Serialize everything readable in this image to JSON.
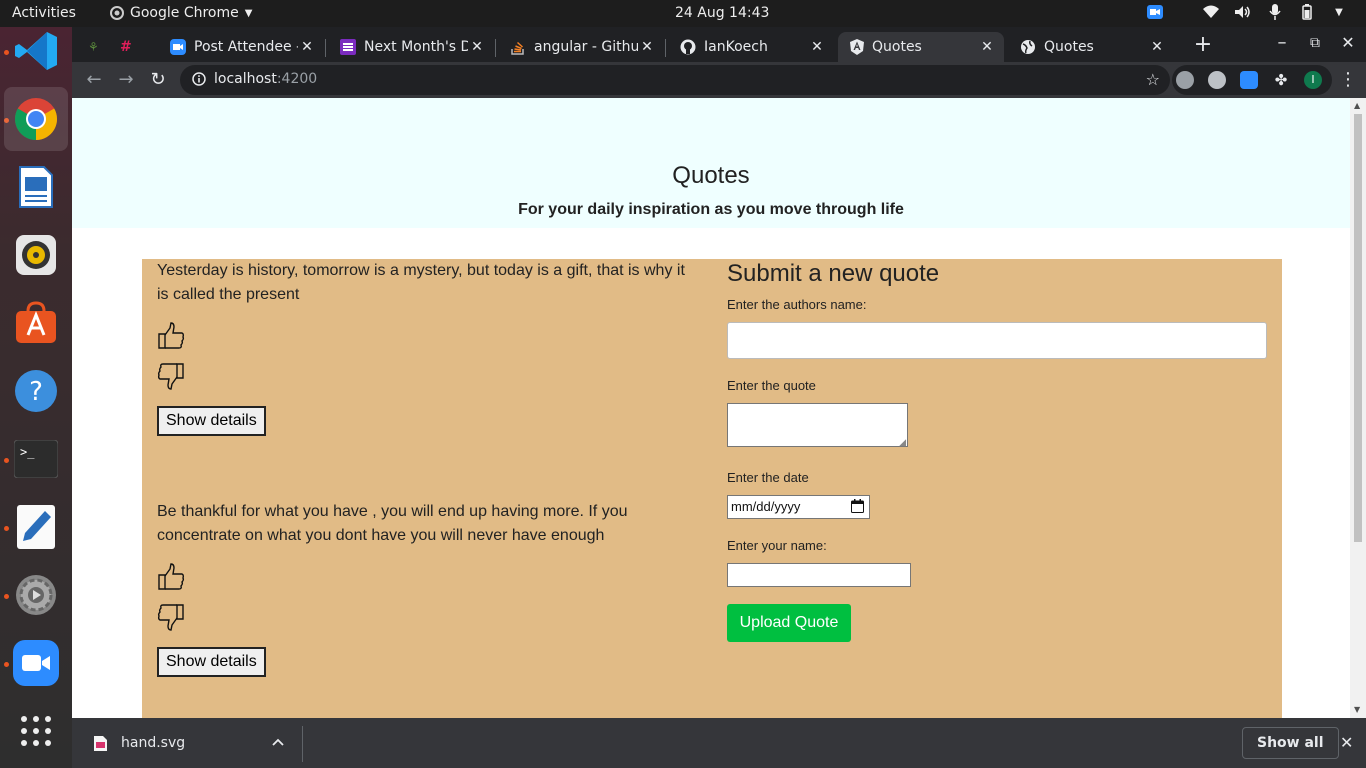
{
  "topbar": {
    "activities": "Activities",
    "app_name": "Google Chrome",
    "clock": "24 Aug  14:43"
  },
  "tabs": [
    {
      "title": "",
      "icon": "pin-icon"
    },
    {
      "title": "",
      "icon": "slack-icon"
    },
    {
      "title": "Post Attendee -",
      "icon": "zoom-icon"
    },
    {
      "title": "Next Month's D",
      "icon": "list-icon"
    },
    {
      "title": "angular - Githut",
      "icon": "stackoverflow-icon"
    },
    {
      "title": "IanKoech",
      "icon": "github-icon"
    },
    {
      "title": "Quotes",
      "icon": "angular-icon"
    },
    {
      "title": "Quotes",
      "icon": "globe-icon"
    }
  ],
  "address": {
    "host": "localhost",
    "port": ":4200"
  },
  "page": {
    "title": "Quotes",
    "subtitle": "For your daily inspiration as you move through life",
    "quotes": [
      {
        "text": "Yesterday is history, tomorrow is a mystery, but today is a gift, that is why it is called the present",
        "details_label": "Show details"
      },
      {
        "text": "Be thankful for what you have , you will end up having more. If you concentrate on what you dont have you will never have enough",
        "details_label": "Show details"
      }
    ],
    "form": {
      "heading": "Submit a new quote",
      "author_label": "Enter the authors name:",
      "quote_label": "Enter the quote",
      "date_label": "Enter the date",
      "date_placeholder": "mm/dd/yyyy",
      "name_label": "Enter your name:",
      "submit_label": "Upload Quote"
    }
  },
  "download_shelf": {
    "file_name": "hand.svg",
    "show_all": "Show all"
  },
  "colors": {
    "hero_bg": "#efffff",
    "panel_bg": "#e1bb86",
    "submit_bg": "#00bf40"
  }
}
